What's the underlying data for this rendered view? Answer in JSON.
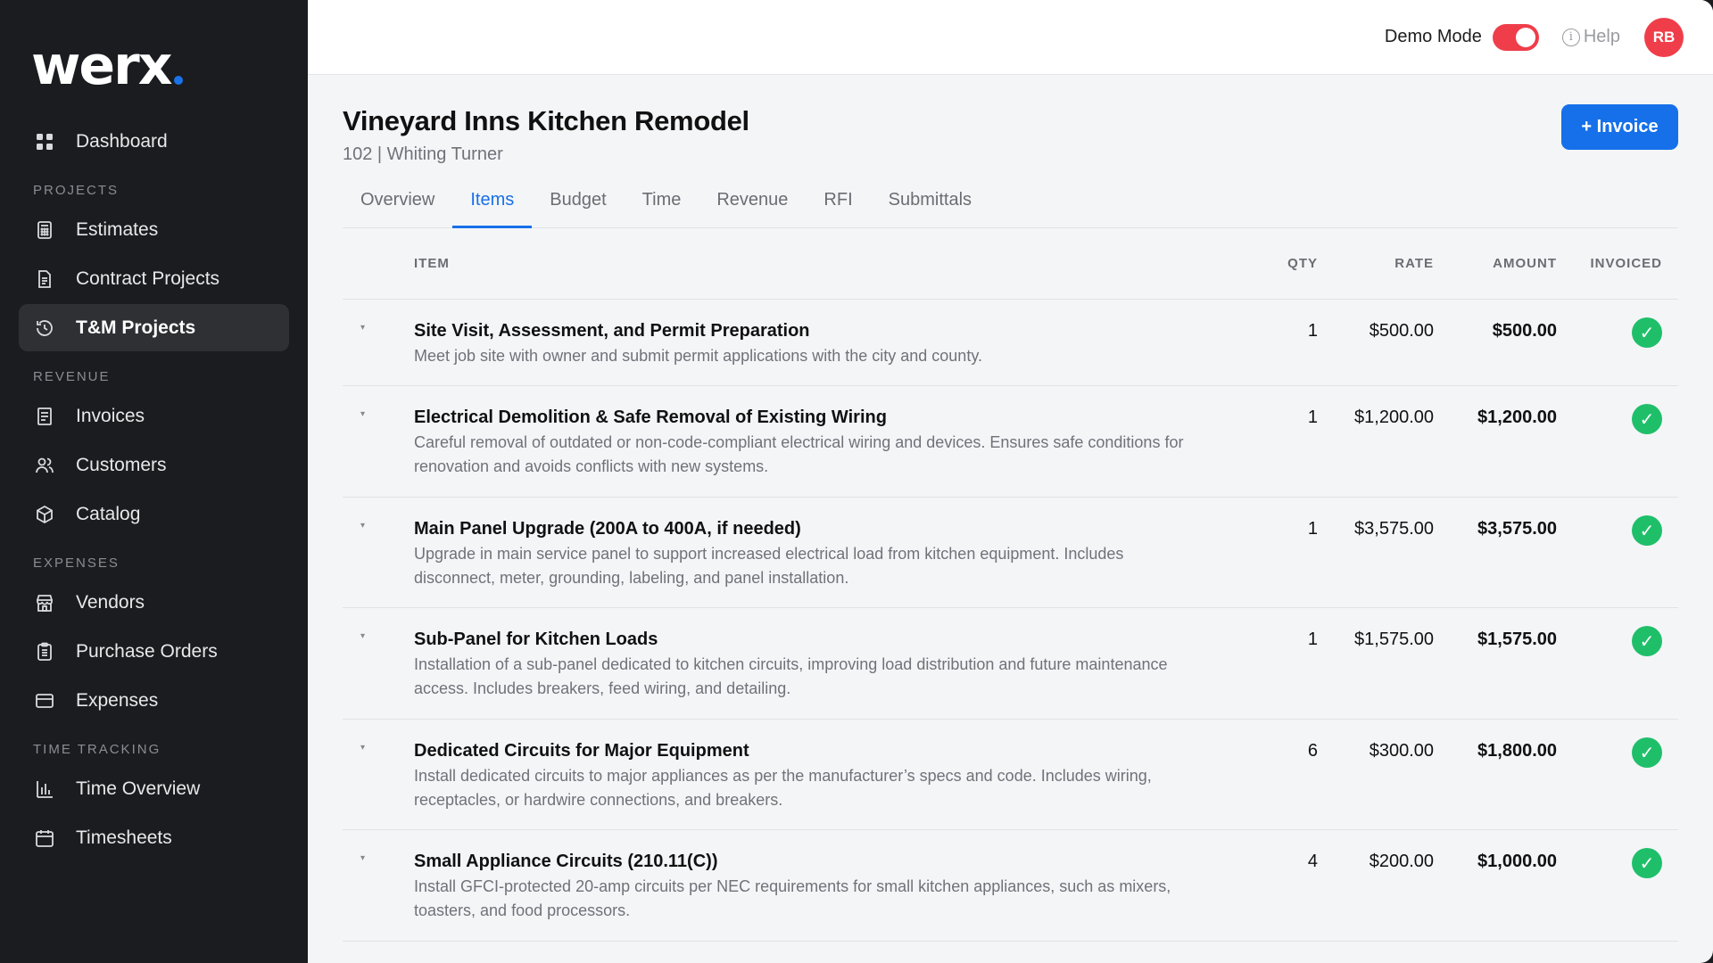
{
  "brand": {
    "name": "werx"
  },
  "sidebar": {
    "dashboard": {
      "label": "Dashboard",
      "icon": "grid-icon"
    },
    "sections": [
      {
        "label": "PROJECTS",
        "items": [
          {
            "label": "Estimates",
            "icon": "calculator-icon"
          },
          {
            "label": "Contract Projects",
            "icon": "document-icon"
          },
          {
            "label": "T&M Projects",
            "icon": "history-icon",
            "active": true
          }
        ]
      },
      {
        "label": "REVENUE",
        "items": [
          {
            "label": "Invoices",
            "icon": "receipt-icon"
          },
          {
            "label": "Customers",
            "icon": "users-icon"
          },
          {
            "label": "Catalog",
            "icon": "box-icon"
          }
        ]
      },
      {
        "label": "EXPENSES",
        "items": [
          {
            "label": "Vendors",
            "icon": "store-icon"
          },
          {
            "label": "Purchase Orders",
            "icon": "clipboard-icon"
          },
          {
            "label": "Expenses",
            "icon": "card-icon"
          }
        ]
      },
      {
        "label": "TIME TRACKING",
        "items": [
          {
            "label": "Time Overview",
            "icon": "bar-chart-icon"
          },
          {
            "label": "Timesheets",
            "icon": "calendar-icon"
          }
        ]
      }
    ]
  },
  "topbar": {
    "demo_mode_label": "Demo Mode",
    "demo_mode_on": true,
    "help_label": "Help",
    "avatar_initials": "RB"
  },
  "project": {
    "title": "Vineyard Inns Kitchen Remodel",
    "subtitle": "102 | Whiting Turner",
    "invoice_button": "+ Invoice"
  },
  "tabs": [
    "Overview",
    "Items",
    "Budget",
    "Time",
    "Revenue",
    "RFI",
    "Submittals"
  ],
  "active_tab": "Items",
  "table": {
    "headers": {
      "item": "ITEM",
      "qty": "QTY",
      "rate": "RATE",
      "amount": "AMOUNT",
      "invoiced": "INVOICED"
    },
    "rows": [
      {
        "name": "Site Visit, Assessment, and Permit Preparation",
        "desc": "Meet job site with owner and submit permit applications with the city and county.",
        "qty": "1",
        "rate": "$500.00",
        "amount": "$500.00",
        "invoiced": true
      },
      {
        "name": "Electrical Demolition & Safe Removal of Existing Wiring",
        "desc": "Careful removal of outdated or non-code-compliant electrical wiring and devices. Ensures safe conditions for renovation and avoids conflicts with new systems.",
        "qty": "1",
        "rate": "$1,200.00",
        "amount": "$1,200.00",
        "invoiced": true
      },
      {
        "name": "Main Panel Upgrade (200A to 400A, if needed)",
        "desc": "Upgrade in main service panel to support increased electrical load from kitchen equipment. Includes disconnect, meter, grounding, labeling, and panel installation.",
        "qty": "1",
        "rate": "$3,575.00",
        "amount": "$3,575.00",
        "invoiced": true
      },
      {
        "name": "Sub-Panel for Kitchen Loads",
        "desc": "Installation of a sub-panel dedicated to kitchen circuits, improving load distribution and future maintenance access. Includes breakers, feed wiring, and detailing.",
        "qty": "1",
        "rate": "$1,575.00",
        "amount": "$1,575.00",
        "invoiced": true
      },
      {
        "name": "Dedicated Circuits for Major Equipment",
        "desc": "Install dedicated circuits to major appliances as per the manufacturer’s specs and code. Includes wiring, receptacles, or hardwire connections, and breakers.",
        "qty": "6",
        "rate": "$300.00",
        "amount": "$1,800.00",
        "invoiced": true
      },
      {
        "name": "Small Appliance Circuits (210.11(C))",
        "desc": "Install GFCI-protected 20-amp circuits per NEC requirements for small kitchen appliances, such as mixers, toasters, and food processors.",
        "qty": "4",
        "rate": "$200.00",
        "amount": "$1,000.00",
        "invoiced": true
      }
    ]
  },
  "colors": {
    "accent": "#1670e9",
    "demo_toggle": "#ef3e4a",
    "invoiced_check": "#1fbf6a",
    "sidebar_bg": "#1b1c1f"
  }
}
